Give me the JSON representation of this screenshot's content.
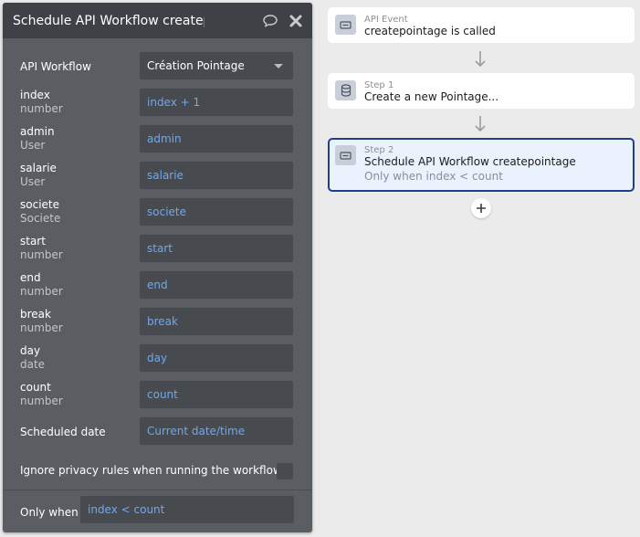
{
  "panel": {
    "title": "Schedule API Workflow createpc",
    "header_icons": [
      "comment-icon",
      "close-icon"
    ],
    "api_workflow": {
      "label": "API Workflow",
      "value": "Création Pointage"
    },
    "params": [
      {
        "name": "index",
        "type": "number",
        "value": "index + 1"
      },
      {
        "name": "admin",
        "type": "User",
        "value": "admin"
      },
      {
        "name": "salarie",
        "type": "User",
        "value": "salarie"
      },
      {
        "name": "societe",
        "type": "Societe",
        "value": "societe"
      },
      {
        "name": "start",
        "type": "number",
        "value": "start"
      },
      {
        "name": "end",
        "type": "number",
        "value": "end"
      },
      {
        "name": "break",
        "type": "number",
        "value": "break"
      },
      {
        "name": "day",
        "type": "date",
        "value": "day"
      },
      {
        "name": "count",
        "type": "number",
        "value": "count"
      }
    ],
    "scheduled_date": {
      "label": "Scheduled date",
      "value": "Current date/time"
    },
    "privacy": {
      "label": "Ignore privacy rules when running the workflow",
      "checked": false
    },
    "only_when": {
      "label": "Only when",
      "value": "index < count"
    }
  },
  "workflow": {
    "cards": [
      {
        "kicker": "API Event",
        "title": "createpointage is called",
        "subtitle": "",
        "icon": "event-icon",
        "selected": false
      },
      {
        "kicker": "Step 1",
        "title": "Create a new Pointage...",
        "subtitle": "",
        "icon": "database-icon",
        "selected": false
      },
      {
        "kicker": "Step 2",
        "title": "Schedule API Workflow createpointage",
        "subtitle": "Only when index < count",
        "icon": "schedule-icon",
        "selected": true
      }
    ],
    "add_step_icon": "plus-icon"
  },
  "colors": {
    "panel_bg": "#5a5e63",
    "panel_header_bg": "#3e4247",
    "field_bg": "#474b50",
    "field_text": "#6fa7ee",
    "selected_border": "#1f3f8a",
    "selected_bg": "#eaf2fd"
  }
}
